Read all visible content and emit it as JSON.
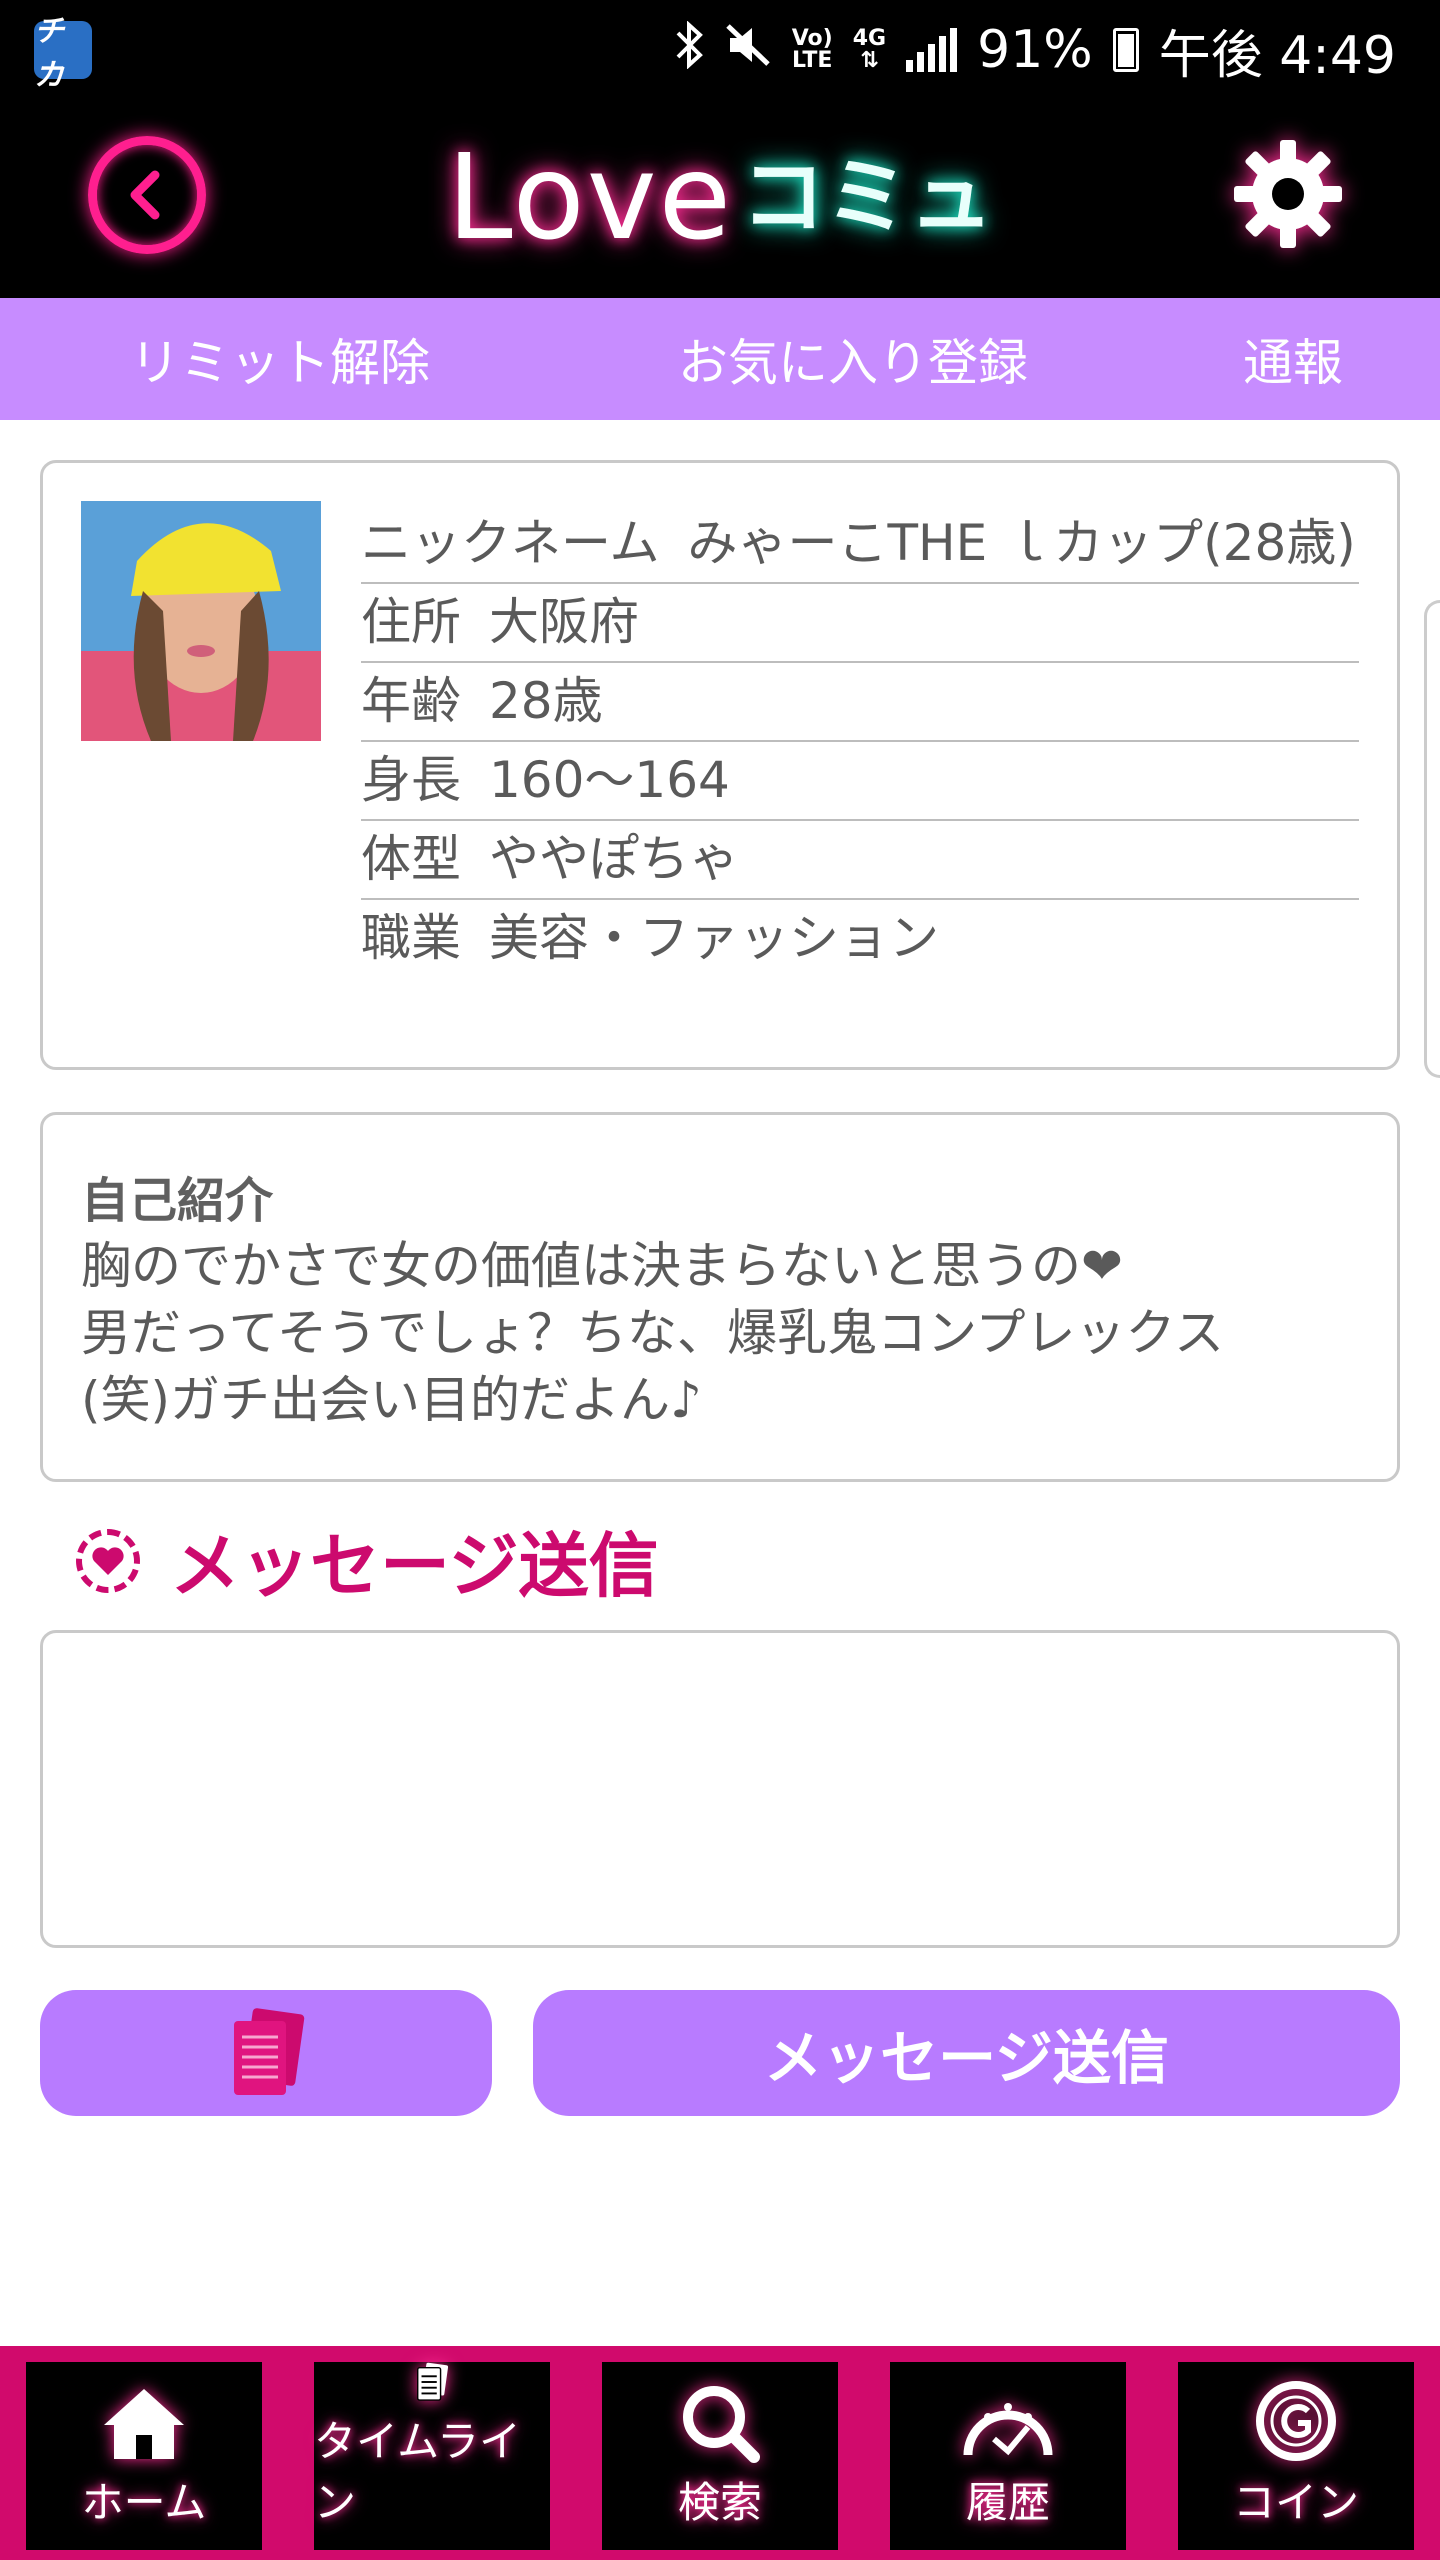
{
  "status_bar": {
    "app_badge": "チカ",
    "network_top": "Vo)",
    "network_bottom": "LTE",
    "network_type": "4G",
    "battery": "91%",
    "time": "午後 4:49"
  },
  "header": {
    "logo_love": "Love",
    "logo_comm": "コミュ"
  },
  "subnav": {
    "limit": "リミット解除",
    "favorite": "お気に入り登録",
    "report": "通報"
  },
  "profile": {
    "rows": [
      {
        "label": "ニックネーム",
        "value": "みゃーこTHE ｌカップ(28歳)"
      },
      {
        "label": "住所",
        "value": "大阪府"
      },
      {
        "label": "年齢",
        "value": "28歳"
      },
      {
        "label": "身長",
        "value": "160〜164"
      },
      {
        "label": "体型",
        "value": "ややぽちゃ"
      },
      {
        "label": "職業",
        "value": "美容・ファッション"
      }
    ]
  },
  "intro": {
    "title": "自己紹介",
    "text": "胸のでかさで女の価値は決まらないと思うの❤\n男だってそうでしょ？ちな、爆乳鬼コンプレックス\n(笑)ガチ出会い目的だよん♪"
  },
  "message": {
    "heading": "メッセージ送信",
    "input_value": "",
    "send_label": "メッセージ送信"
  },
  "bottom_nav": {
    "items": [
      {
        "label": "ホーム",
        "icon": "home-icon"
      },
      {
        "label": "タイムライン",
        "icon": "timeline-icon"
      },
      {
        "label": "検索",
        "icon": "search-icon"
      },
      {
        "label": "履歴",
        "icon": "history-icon"
      },
      {
        "label": "コイン",
        "icon": "coin-icon"
      }
    ]
  },
  "colors": {
    "accent_pink": "#cc0a6e",
    "neon_pink": "#ff1f8f",
    "neon_teal": "#1de9c9",
    "subnav_purple": "#c78cff",
    "button_purple": "#b87bff"
  }
}
